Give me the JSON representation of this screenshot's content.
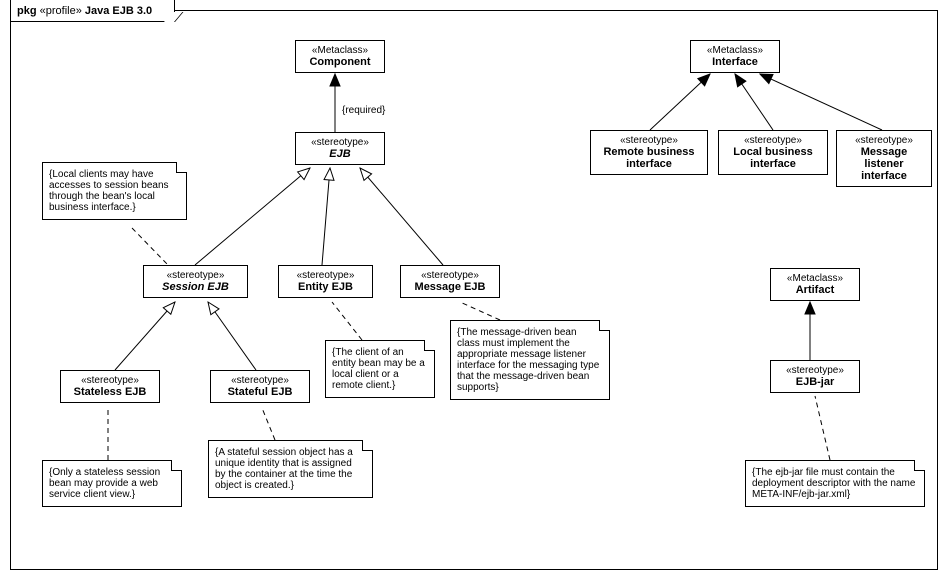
{
  "frame": {
    "pkg_prefix": "pkg",
    "profile_stereo": "«profile»",
    "title": "Java EJB 3.0"
  },
  "nodes": {
    "component": {
      "stereo": "«Metaclass»",
      "name": "Component"
    },
    "ejb": {
      "stereo": "«stereotype»",
      "name": "EJB"
    },
    "session_ejb": {
      "stereo": "«stereotype»",
      "name": "Session EJB"
    },
    "entity_ejb": {
      "stereo": "«stereotype»",
      "name": "Entity EJB"
    },
    "message_ejb": {
      "stereo": "«stereotype»",
      "name": "Message EJB"
    },
    "stateless_ejb": {
      "stereo": "«stereotype»",
      "name": "Stateless EJB"
    },
    "stateful_ejb": {
      "stereo": "«stereotype»",
      "name": "Stateful EJB"
    },
    "interface": {
      "stereo": "«Metaclass»",
      "name": "Interface"
    },
    "remote_if": {
      "stereo": "«stereotype»",
      "name": "Remote business interface"
    },
    "local_if": {
      "stereo": "«stereotype»",
      "name": "Local business interface"
    },
    "msg_listener_if": {
      "stereo": "«stereotype»",
      "name": "Message listener interface"
    },
    "artifact": {
      "stereo": "«Metaclass»",
      "name": "Artifact"
    },
    "ejb_jar": {
      "stereo": "«stereotype»",
      "name": "EJB-jar"
    }
  },
  "labels": {
    "required": "{required}"
  },
  "notes": {
    "local_clients": "{Local clients may have accesses to session beans through the bean's local business interface.}",
    "entity_client": "{The client of an entity bean may be a local client or a remote client.}",
    "message_driven": "{The message-driven bean class must implement the appropriate message listener interface for the messaging type that the message-driven bean supports}",
    "stateless_note": "{Only a stateless session bean may provide a web service client view.}",
    "stateful_note": "{A stateful session object has a unique identity that is assigned by the container at the time the object is created.}",
    "ejb_jar_note": "{The ejb-jar file must contain the deployment descriptor  with the name META-INF/ejb-jar.xml}"
  }
}
